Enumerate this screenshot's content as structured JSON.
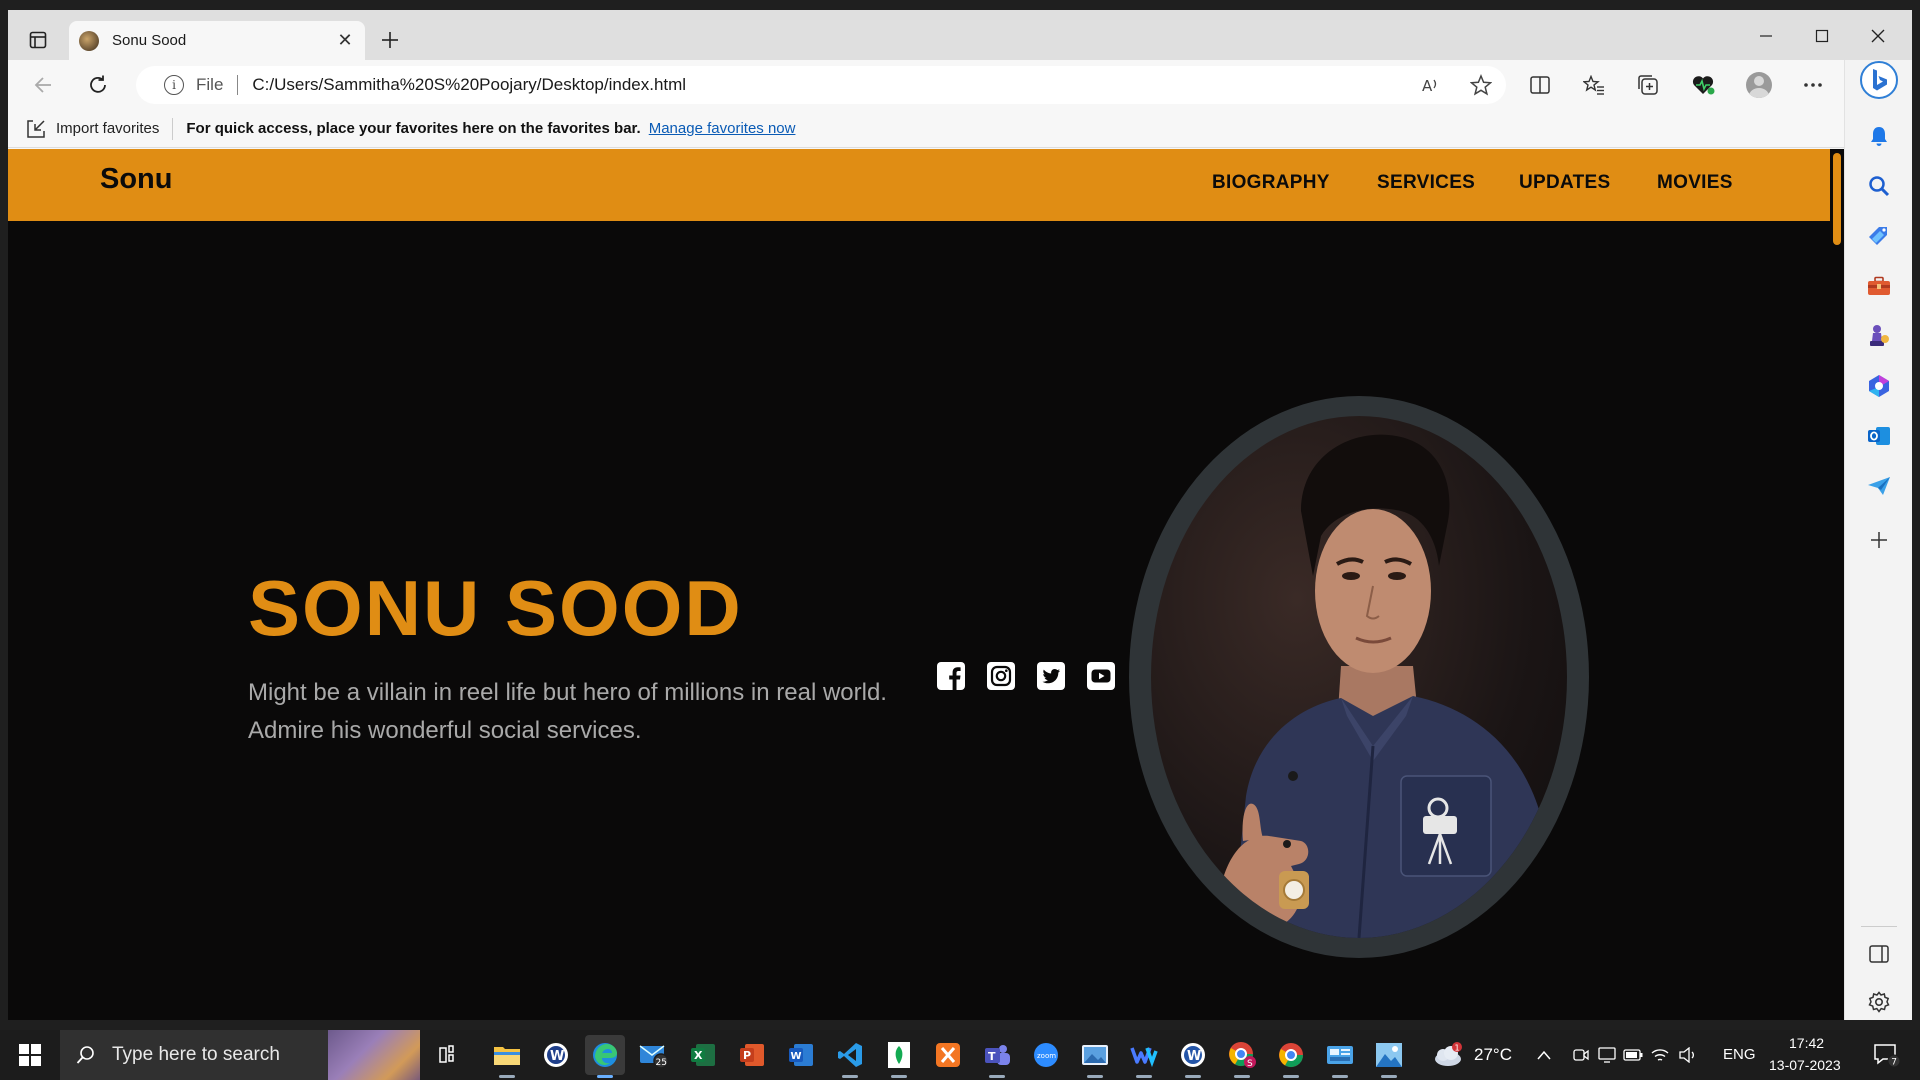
{
  "browser": {
    "tab_title": "Sonu Sood",
    "address_label": "File",
    "url": "C:/Users/Sammitha%20S%20Poojary/Desktop/index.html",
    "favorites_bar": {
      "import_label": "Import favorites",
      "message": "For quick access, place your favorites here on the favorites bar.",
      "link": "Manage favorites now"
    }
  },
  "site": {
    "logo": "Sonu",
    "nav": [
      "BIOGRAPHY",
      "SERVICES",
      "UPDATES",
      "MOVIES"
    ],
    "hero": {
      "title": "SONU SOOD",
      "subtitle": "Might be a villain in reel life but hero of millions in real world. Admire his wonderful social services."
    },
    "social_icons": [
      "facebook-icon",
      "instagram-icon",
      "twitter-icon",
      "youtube-icon"
    ],
    "accent_color": "#e08d14"
  },
  "taskbar": {
    "search_placeholder": "Type here to search",
    "mail_badge": "25",
    "weather_badge": "1",
    "temperature": "27°C",
    "language": "ENG",
    "time": "17:42",
    "date": "13-07-2023",
    "notification_count": "7"
  }
}
